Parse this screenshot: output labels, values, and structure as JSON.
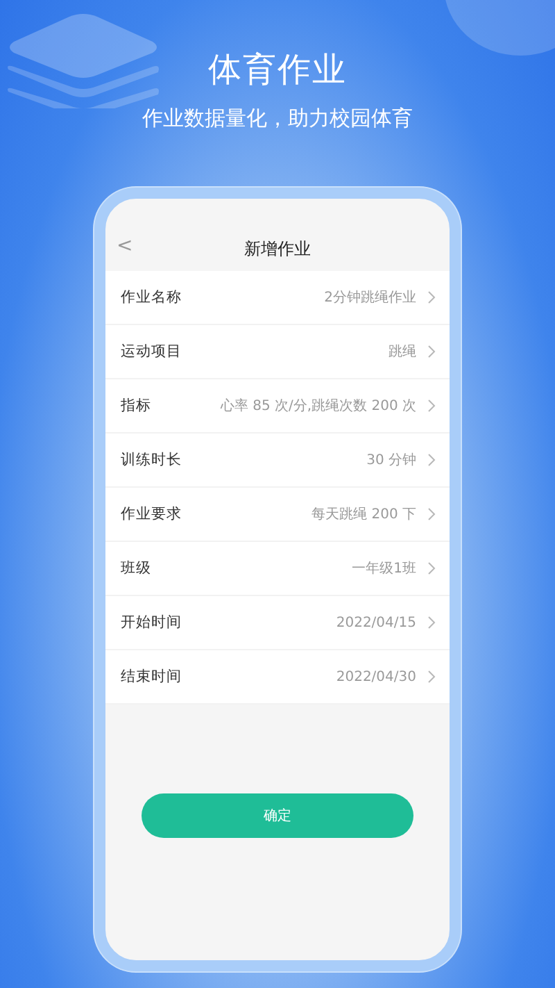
{
  "banner": {
    "title": "体育作业",
    "subtitle": "作业数据量化，助力校园体育"
  },
  "screen": {
    "nav": {
      "back": "<",
      "title": "新增作业"
    },
    "fields": [
      {
        "label": "作业名称",
        "value": "2分钟跳绳作业"
      },
      {
        "label": "运动项目",
        "value": "跳绳"
      },
      {
        "label": "指标",
        "value": "心率 85 次/分,跳绳次数 200 次"
      },
      {
        "label": "训练时长",
        "value": "30 分钟"
      },
      {
        "label": "作业要求",
        "value": "每天跳绳 200 下"
      },
      {
        "label": "班级",
        "value": "一年级1班"
      },
      {
        "label": "开始时间",
        "value": "2022/04/15"
      },
      {
        "label": "结束时间",
        "value": "2022/04/30"
      }
    ],
    "confirm_button": "确定"
  }
}
